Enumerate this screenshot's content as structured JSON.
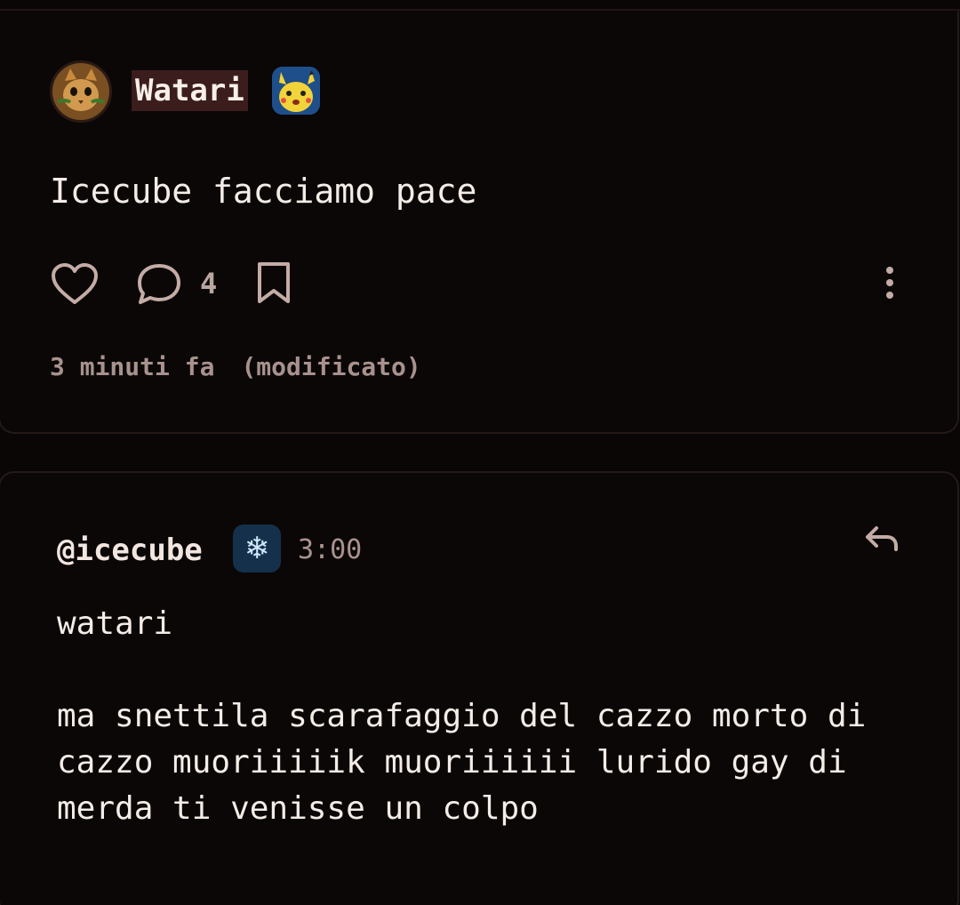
{
  "post": {
    "author": "Watari",
    "author_badge_icon": "pikachu-badge",
    "avatar_icon": "cat-avatar",
    "text": "Icecube facciamo pace",
    "actions": {
      "like_icon": "heart-icon",
      "comment_icon": "comment-bubble-icon",
      "comment_count": "4",
      "bookmark_icon": "bookmark-icon",
      "more_icon": "vertical-dots-icon"
    },
    "time_ago": "3 minuti fa",
    "edited_label": "(modificato)"
  },
  "comment": {
    "author": "@icecube",
    "author_badge_icon": "snowflake-badge",
    "badge_glyph": "❄",
    "time": "3:00",
    "reply_icon": "reply-arrow-icon",
    "paragraphs": [
      "watari",
      "ma snettila scarafaggio del cazzo morto di cazzo muoriiiiik muoriiiiii lurido gay di merda ti venisse un colpo"
    ]
  },
  "colors": {
    "background": "#0a0606",
    "card_border": "#241a18",
    "username_highlight": "#3a1d1c",
    "muted_text": "#a8928d",
    "icon_color": "#c4aca6"
  }
}
